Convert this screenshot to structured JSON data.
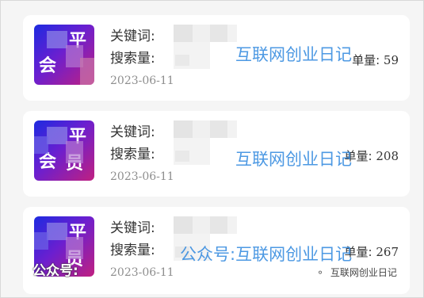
{
  "cards": [
    {
      "keyword_label": "关键词:",
      "search_label": "搜索量:",
      "date": "2023-06-11",
      "volume_label": "单量:",
      "volume": "59",
      "thumb_chars": [
        "平",
        "会",
        ""
      ]
    },
    {
      "keyword_label": "关键词:",
      "search_label": "搜索量:",
      "date": "2023-06-11",
      "volume_label": "单量:",
      "volume": "208",
      "thumb_chars": [
        "平",
        "会",
        "员"
      ]
    },
    {
      "keyword_label": "关键词:",
      "search_label": "搜索量:",
      "date": "2023-06-11",
      "volume_label": "单量:",
      "volume": "267",
      "thumb_chars": [
        "平",
        "",
        "员"
      ]
    }
  ],
  "watermarks": [
    "互联网创业日记",
    "互联网创业日记",
    "公众号:互联网创业日记"
  ],
  "overlay_text": "公众号:",
  "footer_brand": "互联网创业日记",
  "colors": {
    "watermark": "#3a8ee0",
    "thumb_start": "#1d2be0",
    "thumb_end": "#c02080"
  }
}
